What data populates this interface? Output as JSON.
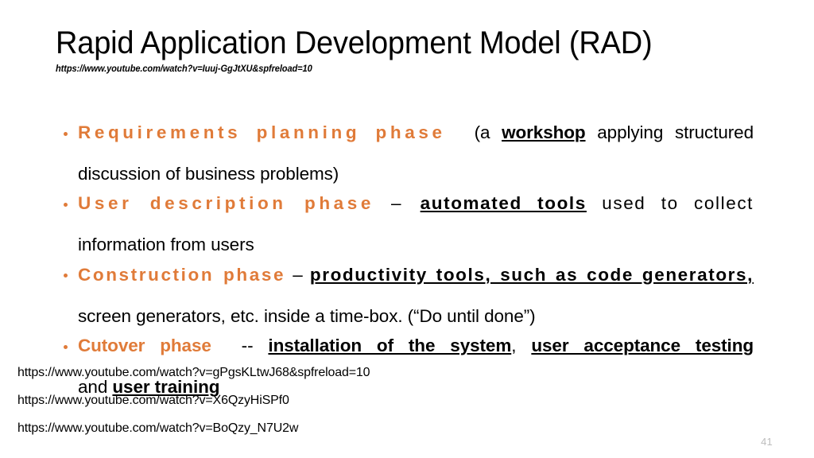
{
  "slide": {
    "title": "Rapid Application Development Model (RAD)",
    "title_url": "https://www.youtube.com/watch?v=Iuuj-GgJtXU&spfreload=10",
    "accent_color": "#E07B39",
    "text_color": "#000000",
    "background_color": "#FFFFFF",
    "slide_number": "41",
    "slide_number_color": "#BDBDBD"
  },
  "bullets": [
    {
      "phase": "Requirements planning phase",
      "connector": "",
      "line1_rest_a": "(a ",
      "emphasis": "workshop",
      "line1_rest_b": " applying structured",
      "line2": "discussion of business problems)",
      "full_text": "Requirements planning phase  (a workshop applying structured discussion of business problems)"
    },
    {
      "phase": "User description phase",
      "connector": "–",
      "line1_rest_a": "",
      "emphasis": "automated tools",
      "line1_rest_b": " used to collect",
      "line2": "information from users",
      "full_text": "User description phase – automated tools used to collect information from users"
    },
    {
      "phase": "Construction phase",
      "connector": "–",
      "line1_rest_a": "",
      "emphasis": "productivity tools, such as code generators,",
      "line1_rest_b": "",
      "line2": "screen generators, etc. inside a time-box. (“Do until done”)",
      "full_text": "Construction phase – productivity tools, such as code generators, screen generators, etc. inside a time-box. (“Do until done”)"
    },
    {
      "phase": "Cutover phase",
      "connector": "--",
      "line1_rest_a": "",
      "emphasis": "installation of the system",
      "emphasis2": "user acceptance testing",
      "line1_rest_b": ", ",
      "line2_prefix": "and ",
      "line2_emphasis": "user training",
      "full_text": "Cutover phase -- installation of the system, user acceptance testing and user training"
    }
  ],
  "footer_links": [
    "https://www.youtube.com/watch?v=gPgsKLtwJ68&spfreload=10",
    "https://www.youtube.com/watch?v=X6QzyHiSPf0",
    "https://www.youtube.com/watch?v=BoQzy_N7U2w"
  ]
}
